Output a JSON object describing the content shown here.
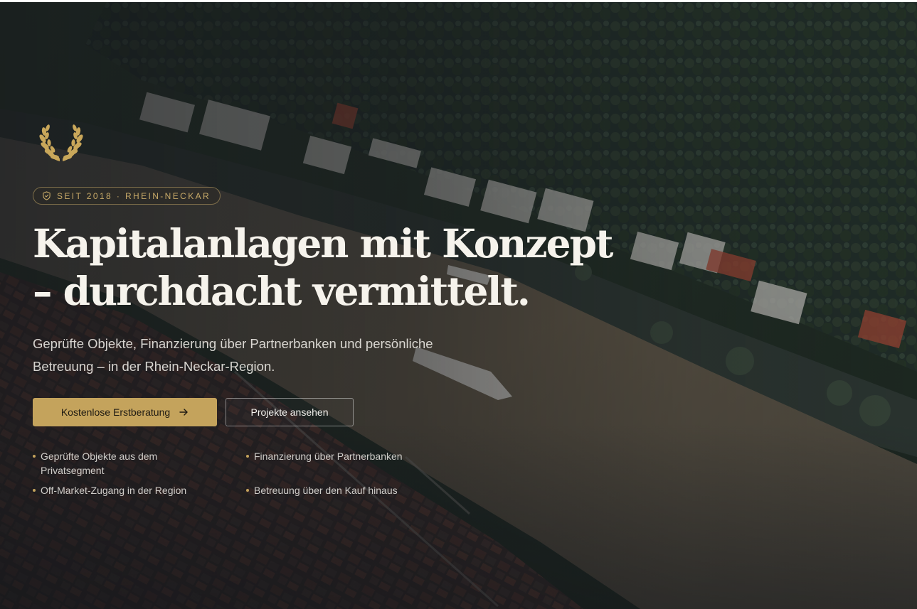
{
  "hero": {
    "badge": {
      "icon": "shield-icon",
      "text": "SEIT 2018 · RHEIN-NECKAR"
    },
    "emblem_icon": "laurel-wreath-icon",
    "headline": {
      "line1": "Kapitalanlagen mit Konzept",
      "line2": "– durchdacht vermittelt."
    },
    "subline": "Geprüfte Objekte, Finanzierung über Partnerbanken und persönliche Betreuung – in der Rhein-Neckar-Region.",
    "primary_cta": {
      "label": "Kostenlose Erstberatung",
      "icon": "arrow-right-icon"
    },
    "secondary_cta": {
      "label": "Projekte ansehen"
    },
    "features": [
      "Geprüfte Objekte aus dem Privatsegment",
      "Finanzierung über Partnerbanken",
      "Off-Market-Zugang in der Region",
      "Betreuung über den Kauf hinaus"
    ]
  },
  "colors": {
    "accent_gold": "#c4a35c",
    "badge_gold": "#c7a968",
    "headline_white": "#f6f3ec"
  }
}
